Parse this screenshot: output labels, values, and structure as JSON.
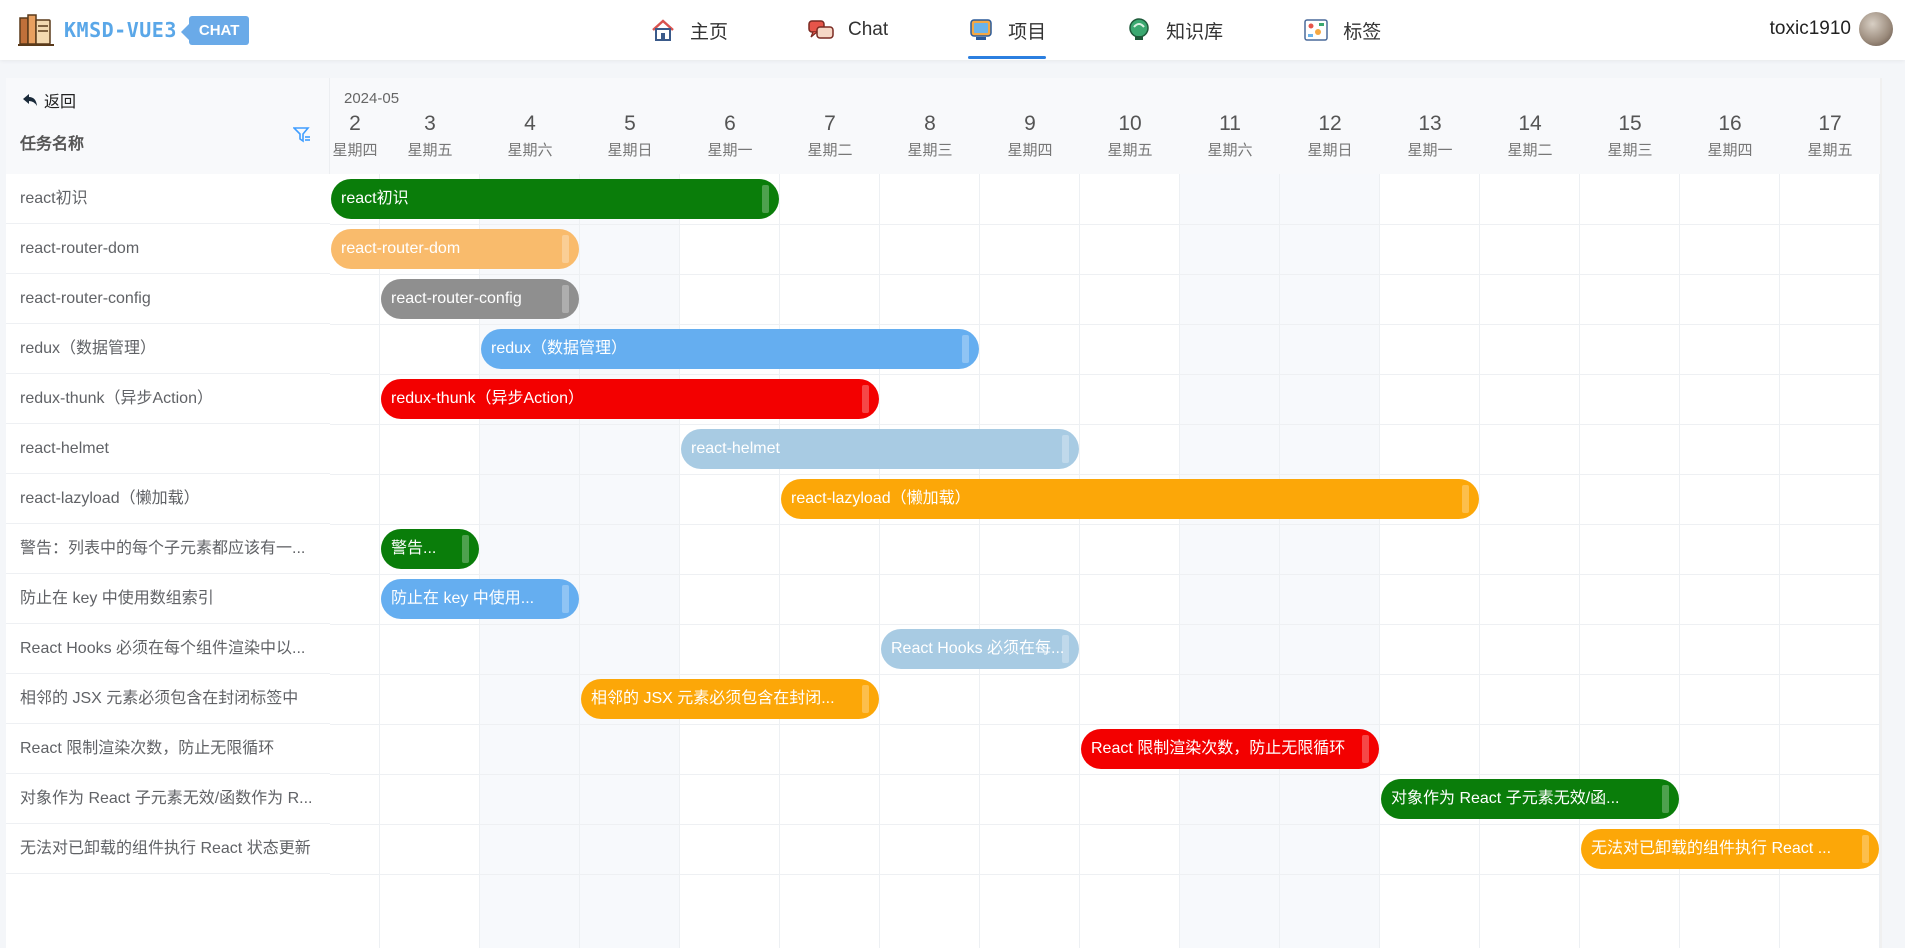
{
  "header": {
    "brand_name": "KMSD-VUE3",
    "brand_tag": "CHAT",
    "nav": [
      {
        "label": "主页",
        "icon": "home-icon"
      },
      {
        "label": "Chat",
        "icon": "chat-icon"
      },
      {
        "label": "项目",
        "icon": "project-icon",
        "active": true
      },
      {
        "label": "知识库",
        "icon": "knowledge-icon"
      },
      {
        "label": "标签",
        "icon": "tag-icon"
      }
    ],
    "username": "toxic1910"
  },
  "gantt": {
    "back_label": "返回",
    "column_title": "任务名称",
    "month_label": "2024-05",
    "days": [
      {
        "day": "2",
        "week": "星期四"
      },
      {
        "day": "3",
        "week": "星期五"
      },
      {
        "day": "4",
        "week": "星期六"
      },
      {
        "day": "5",
        "week": "星期日"
      },
      {
        "day": "6",
        "week": "星期一"
      },
      {
        "day": "7",
        "week": "星期二"
      },
      {
        "day": "8",
        "week": "星期三"
      },
      {
        "day": "9",
        "week": "星期四"
      },
      {
        "day": "10",
        "week": "星期五"
      },
      {
        "day": "11",
        "week": "星期六"
      },
      {
        "day": "12",
        "week": "星期日"
      },
      {
        "day": "13",
        "week": "星期一"
      },
      {
        "day": "14",
        "week": "星期二"
      },
      {
        "day": "15",
        "week": "星期三"
      },
      {
        "day": "16",
        "week": "星期四"
      },
      {
        "day": "17",
        "week": "星期五"
      }
    ],
    "tasks": [
      {
        "name": "react初识",
        "bar_label": "react初识",
        "start": "2024-05-02",
        "end": "2024-05-06",
        "color": "#0a7d0a"
      },
      {
        "name": "react-router-dom",
        "bar_label": "react-router-dom",
        "start": "2024-05-02",
        "end": "2024-05-04",
        "color": "#f9bb6c"
      },
      {
        "name": "react-router-config",
        "bar_label": "react-router-config",
        "start": "2024-05-03",
        "end": "2024-05-04",
        "color": "#8f8f8f"
      },
      {
        "name": "redux（数据管理）",
        "bar_label": "redux（数据管理）",
        "start": "2024-05-04",
        "end": "2024-05-08",
        "color": "#65aef0"
      },
      {
        "name": "redux-thunk（异步Action）",
        "bar_label": "redux-thunk（异步Action）",
        "start": "2024-05-03",
        "end": "2024-05-07",
        "color": "#f30000"
      },
      {
        "name": "react-helmet",
        "bar_label": "react-helmet",
        "start": "2024-05-06",
        "end": "2024-05-09",
        "color": "#a8cbe3"
      },
      {
        "name": "react-lazyload（懒加载）",
        "bar_label": "react-lazyload（懒加载）",
        "start": "2024-05-07",
        "end": "2024-05-13",
        "color": "#fca708"
      },
      {
        "name": "警告：列表中的每个子元素都应该有一...",
        "bar_label": "警告...",
        "start": "2024-05-03",
        "end": "2024-05-03",
        "color": "#0a7d0a"
      },
      {
        "name": "防止在 key 中使用数组索引",
        "bar_label": "防止在 key 中使用...",
        "start": "2024-05-03",
        "end": "2024-05-04",
        "color": "#65aef0"
      },
      {
        "name": "React Hooks 必须在每个组件渲染中以...",
        "bar_label": "React Hooks 必须在每...",
        "start": "2024-05-08",
        "end": "2024-05-09",
        "color": "#a8cbe3"
      },
      {
        "name": "相邻的 JSX 元素必须包含在封闭标签中",
        "bar_label": "相邻的 JSX 元素必须包含在封闭...",
        "start": "2024-05-05",
        "end": "2024-05-07",
        "color": "#fca708"
      },
      {
        "name": "React 限制渲染次数，防止无限循环",
        "bar_label": "React 限制渲染次数，防止无限循环",
        "start": "2024-05-10",
        "end": "2024-05-12",
        "color": "#f30000"
      },
      {
        "name": "对象作为 React 子元素无效/函数作为 R...",
        "bar_label": "对象作为 React 子元素无效/函...",
        "start": "2024-05-13",
        "end": "2024-05-15",
        "color": "#0a7d0a"
      },
      {
        "name": "无法对已卸载的组件执行 React 状态更新",
        "bar_label": "无法对已卸载的组件执行 React ...",
        "start": "2024-05-15",
        "end": "2024-05-17",
        "color": "#fca708"
      }
    ]
  }
}
